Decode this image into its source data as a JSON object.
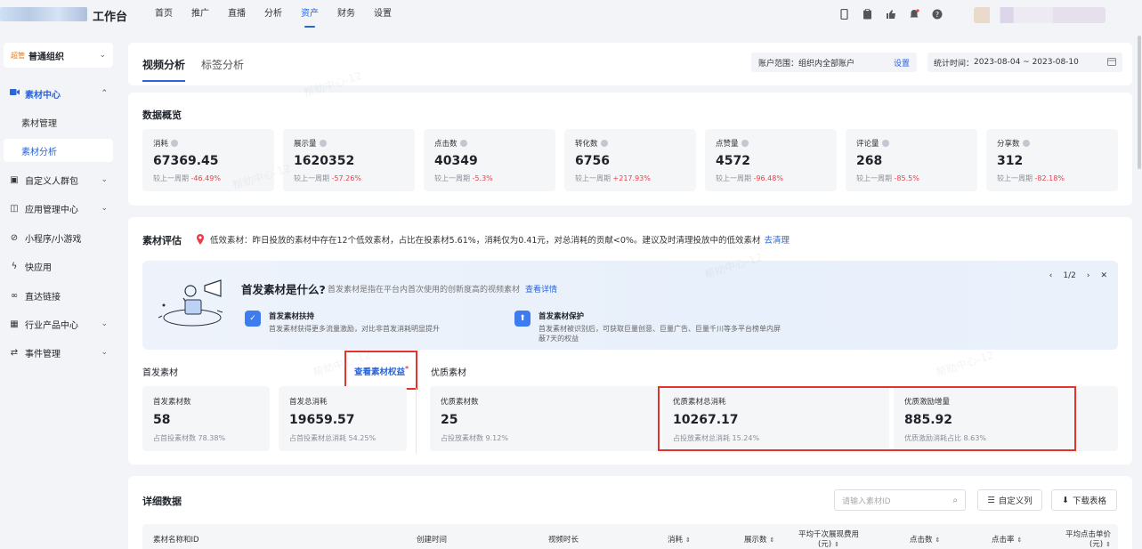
{
  "app": {
    "title": "工作台"
  },
  "nav": {
    "items": [
      "首页",
      "推广",
      "直播",
      "分析",
      "资产",
      "财务",
      "设置"
    ],
    "active": "资产"
  },
  "sidebar": {
    "org": {
      "tag": "超管",
      "name": "普通组织"
    },
    "items": [
      {
        "label": "素材中心",
        "icon": "video-icon"
      },
      {
        "label": "素材管理"
      },
      {
        "label": "素材分析"
      },
      {
        "label": "自定义人群包",
        "icon": "audience-icon"
      },
      {
        "label": "应用管理中心",
        "icon": "app-icon"
      },
      {
        "label": "小程序/小游戏",
        "icon": "miniprogram-icon"
      },
      {
        "label": "快应用",
        "icon": "flash-icon"
      },
      {
        "label": "直达链接",
        "icon": "link-icon"
      },
      {
        "label": "行业产品中心",
        "icon": "grid-icon"
      },
      {
        "label": "事件管理",
        "icon": "event-icon"
      }
    ]
  },
  "tabs": {
    "active": "视频分析",
    "second": "标签分析"
  },
  "filters": {
    "account_label": "账户范围：组织内全部账户",
    "account_link": "设置",
    "date_label": "统计时间：",
    "date_range": "2023-08-04 ~ 2023-08-10"
  },
  "overview": {
    "title": "数据概览",
    "metrics": [
      {
        "label": "消耗",
        "value": "67369.45",
        "cmp_label": "较上一周期",
        "cmp": "-46.49%"
      },
      {
        "label": "展示量",
        "value": "1620352",
        "cmp_label": "较上一周期",
        "cmp": "-57.26%"
      },
      {
        "label": "点击数",
        "value": "40349",
        "cmp_label": "较上一周期",
        "cmp": "-5.3%"
      },
      {
        "label": "转化数",
        "value": "6756",
        "cmp_label": "较上一周期",
        "cmp": "+217.93%"
      },
      {
        "label": "点赞量",
        "value": "4572",
        "cmp_label": "较上一周期",
        "cmp": "-96.48%"
      },
      {
        "label": "评论量",
        "value": "268",
        "cmp_label": "较上一周期",
        "cmp": "-85.5%"
      },
      {
        "label": "分享数",
        "value": "312",
        "cmp_label": "较上一周期",
        "cmp": "-82.18%"
      }
    ]
  },
  "evaluation": {
    "title": "素材评估",
    "tip": "低效素材：昨日投放的素材中存在12个低效素材，占比在投素材5.61%，消耗仅为0.41元，对总消耗的贡献<0%。建议及时清理投放中的低效素材",
    "tip_link": "去清理",
    "banner": {
      "title": "首发素材是什么?",
      "desc": "首发素材是指在平台内首次使用的创新度高的视频素材",
      "link": "查看详情",
      "pager": "1/2",
      "features": [
        {
          "title": "首发素材扶持",
          "desc": "首发素材获得更多流量激励，对比非首发消耗明显提升"
        },
        {
          "title": "首发素材保护",
          "desc": "首发素材被识别后，可获取巨量创意、巨量广告、巨量千川等多平台榜单内屏蔽7天的权益"
        }
      ]
    },
    "first_title": "首发素材",
    "rights_link": "查看素材权益",
    "quality_title": "优质素材",
    "first_stats": [
      {
        "label": "首发素材数",
        "value": "58",
        "sub": "占首投素材数 78.38%"
      },
      {
        "label": "首发总消耗",
        "value": "19659.57",
        "sub": "占首投素材总消耗 54.25%"
      }
    ],
    "quality_stats": [
      {
        "label": "优质素材数",
        "value": "25",
        "sub": "占投放素材数 9.12%"
      },
      {
        "label": "优质素材总消耗",
        "value": "10267.17",
        "sub": "占投放素材总消耗 15.24%"
      },
      {
        "label": "优质激励增量",
        "value": "885.92",
        "sub": "优质激励消耗占比 8.63%"
      }
    ]
  },
  "detail": {
    "title": "详细数据",
    "search_placeholder": "请输入素材ID",
    "custom_cols": "自定义列",
    "download": "下载表格",
    "columns": [
      "素材名称和ID",
      "创建时间",
      "视频时长",
      "消耗",
      "展示数",
      "平均千次展现费用(元)",
      "点击数",
      "点击率",
      "平均点击单价(元)"
    ]
  },
  "watermark": "帮助中心-12"
}
